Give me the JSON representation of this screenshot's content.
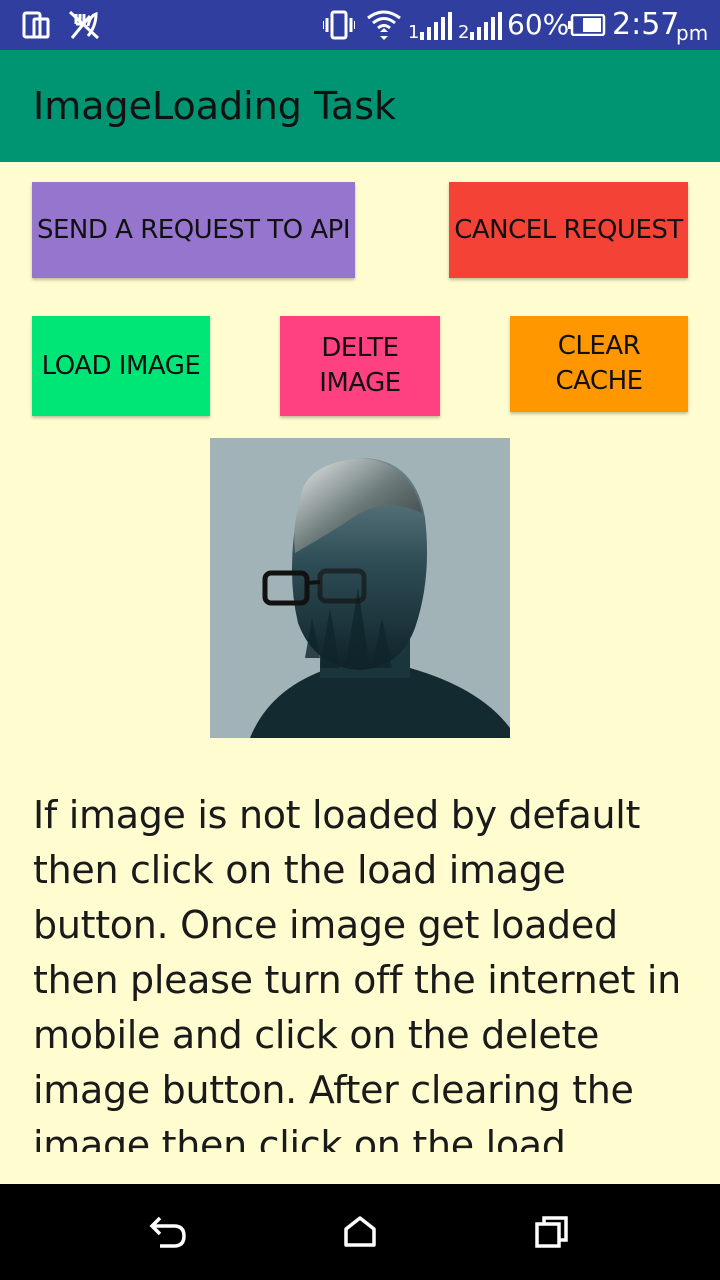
{
  "status_bar": {
    "battery_percent": "60%",
    "time": "2:57",
    "ampm": "pm",
    "sim1": "1",
    "sim2": "2"
  },
  "app_bar": {
    "title": "ImageLoading Task"
  },
  "buttons": {
    "send_request": {
      "label": "SEND A REQUEST TO API",
      "color": "#9575CD"
    },
    "cancel_request": {
      "label": "CANCEL REQUEST",
      "color": "#F44336"
    },
    "load_image": {
      "label": "LOAD IMAGE",
      "color": "#00E676"
    },
    "delete_image": {
      "label": "DELTE IMAGE",
      "color": "#FF4081"
    },
    "clear_cache": {
      "label": "CLEAR CACHE",
      "color": "#FF9800"
    }
  },
  "image": {
    "icon": "double-exposure-portrait"
  },
  "instructions": "If image is not loaded by default then click on the load image button. Once image get loaded then please turn off the internet in mobile and click on the delete image button. After clearing the image then click on the load",
  "nav_bar": {
    "back": "back-icon",
    "home": "home-icon",
    "recents": "recents-icon"
  }
}
